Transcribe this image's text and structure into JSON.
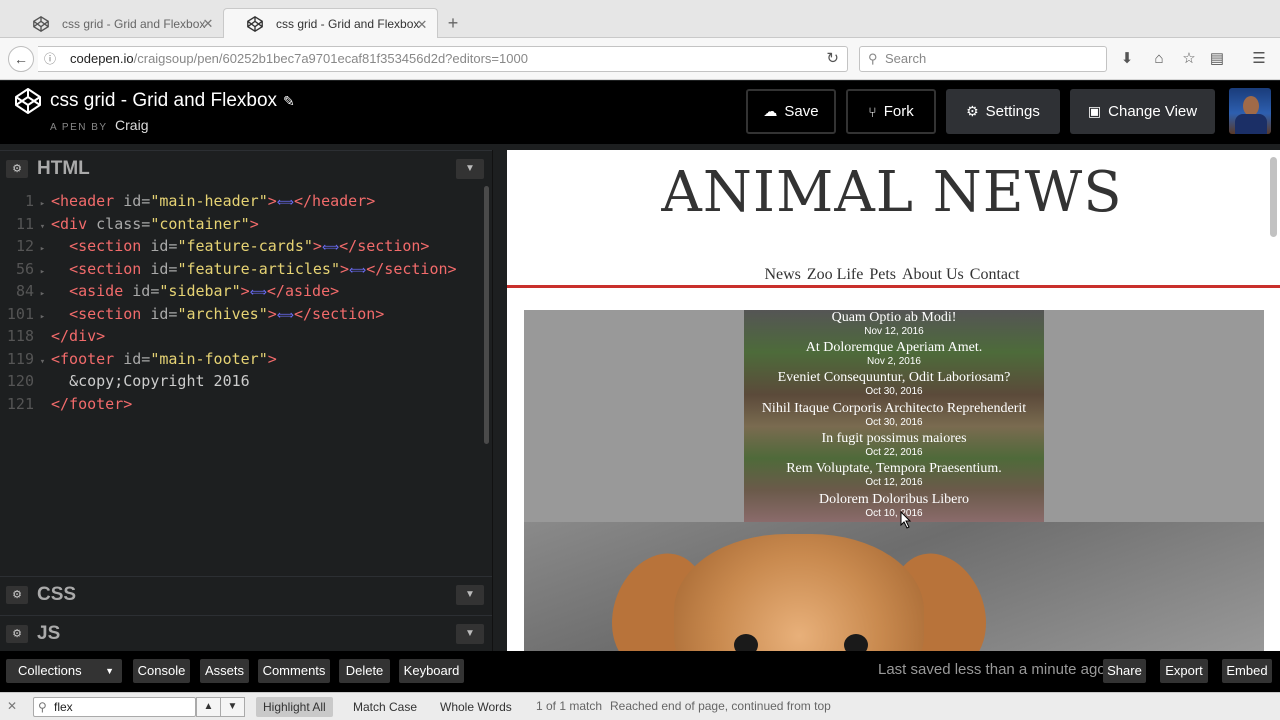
{
  "browser": {
    "tabs": [
      {
        "title": "css grid - Grid and Flexbox",
        "icon": "codepen-favicon",
        "active": false
      },
      {
        "title": "css grid - Grid and Flexbox",
        "icon": "codepen-favicon",
        "active": true
      }
    ],
    "url_host": "codepen.io",
    "url_path": "/craigsoup/pen/60252b1bec7a9701ecaf81f353456d2d?editors=1000",
    "search_placeholder": "Search"
  },
  "header": {
    "title": "css grid - Grid and Flexbox",
    "byline_prefix": "A PEN BY",
    "author": "Craig",
    "buttons": {
      "save": "Save",
      "fork": "Fork",
      "settings": "Settings",
      "change_view": "Change View"
    }
  },
  "editor": {
    "html_panel": "HTML",
    "css_panel": "CSS",
    "js_panel": "JS",
    "lines": [
      {
        "n": "1",
        "fold": "▸",
        "indent": "",
        "parts": [
          [
            "tag",
            "<header "
          ],
          [
            "attr",
            "id="
          ],
          [
            "str",
            "\"main-header\""
          ],
          [
            "tag",
            ">"
          ],
          [
            "fw",
            "⟺"
          ],
          [
            "tag",
            "</header>"
          ]
        ]
      },
      {
        "n": "11",
        "fold": "▾",
        "indent": "",
        "parts": [
          [
            "tag",
            "<div "
          ],
          [
            "attr",
            "class="
          ],
          [
            "str",
            "\"container\""
          ],
          [
            "tag",
            ">"
          ]
        ]
      },
      {
        "n": "12",
        "fold": "▸",
        "indent": "  ",
        "parts": [
          [
            "tag",
            "<section "
          ],
          [
            "attr",
            "id="
          ],
          [
            "str",
            "\"feature-cards\""
          ],
          [
            "tag",
            ">"
          ],
          [
            "fw",
            "⟺"
          ],
          [
            "tag",
            "</section>"
          ]
        ]
      },
      {
        "n": "56",
        "fold": "▸",
        "indent": "  ",
        "parts": [
          [
            "tag",
            "<section "
          ],
          [
            "attr",
            "id="
          ],
          [
            "str",
            "\"feature-articles\""
          ],
          [
            "tag",
            ">"
          ],
          [
            "fw",
            "⟺"
          ],
          [
            "tag",
            "</section>"
          ]
        ]
      },
      {
        "n": "84",
        "fold": "▸",
        "indent": "  ",
        "parts": [
          [
            "tag",
            "<aside "
          ],
          [
            "attr",
            "id="
          ],
          [
            "str",
            "\"sidebar\""
          ],
          [
            "tag",
            ">"
          ],
          [
            "fw",
            "⟺"
          ],
          [
            "tag",
            "</aside>"
          ]
        ]
      },
      {
        "n": "101",
        "fold": "▸",
        "indent": "  ",
        "parts": [
          [
            "tag",
            "<section "
          ],
          [
            "attr",
            "id="
          ],
          [
            "str",
            "\"archives\""
          ],
          [
            "tag",
            ">"
          ],
          [
            "fw",
            "⟺"
          ],
          [
            "tag",
            "</section>"
          ]
        ]
      },
      {
        "n": "118",
        "fold": "",
        "indent": "",
        "parts": [
          [
            "tag",
            "</div>"
          ]
        ]
      },
      {
        "n": "119",
        "fold": "▾",
        "indent": "",
        "parts": [
          [
            "tag",
            "<footer "
          ],
          [
            "attr",
            "id="
          ],
          [
            "str",
            "\"main-footer\""
          ],
          [
            "tag",
            ">"
          ]
        ]
      },
      {
        "n": "120",
        "fold": "",
        "indent": "  ",
        "parts": [
          [
            "txt",
            "&copy;Copyright 2016"
          ]
        ]
      },
      {
        "n": "121",
        "fold": "",
        "indent": "",
        "parts": [
          [
            "tag",
            "</footer>"
          ]
        ]
      }
    ]
  },
  "preview": {
    "site_title": "ANIMAL NEWS",
    "nav": [
      "News",
      "Zoo Life",
      "Pets",
      "About Us",
      "Contact"
    ],
    "cards": [
      {
        "title": "Quam Optio ab Modi!",
        "date": "Nov 12, 2016"
      },
      {
        "title": "At Doloremque Aperiam Amet.",
        "date": "Nov 2, 2016"
      },
      {
        "title": "Eveniet Consequuntur, Odit Laboriosam?",
        "date": "Oct 30, 2016"
      },
      {
        "title": "Nihil Itaque Corporis Architecto Reprehenderit",
        "date": "Oct 30, 2016"
      },
      {
        "title": "In fugit possimus maiores",
        "date": "Oct 22, 2016"
      },
      {
        "title": "Rem Voluptate, Tempora Praesentium.",
        "date": "Oct 12, 2016"
      },
      {
        "title": "Dolorem Doloribus Libero",
        "date": "Oct 10, 2016"
      }
    ]
  },
  "footer": {
    "collections": "Collections",
    "console": "Console",
    "assets": "Assets",
    "comments": "Comments",
    "delete": "Delete",
    "keyboard": "Keyboard",
    "status": "Last saved less than a minute ago",
    "share": "Share",
    "export": "Export",
    "embed": "Embed"
  },
  "findbar": {
    "query": "flex",
    "highlight_all": "Highlight All",
    "match_case": "Match Case",
    "whole_words": "Whole Words",
    "match_count": "1 of 1 match",
    "status": "Reached end of page, continued from top"
  }
}
